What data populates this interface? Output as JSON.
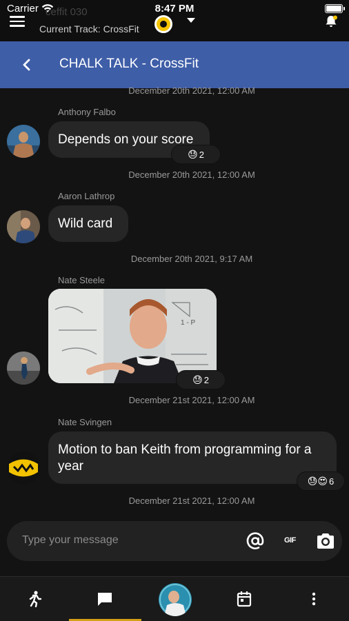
{
  "status": {
    "carrier": "Carrier",
    "time": "8:47 PM",
    "battery_level": 1.0
  },
  "header": {
    "ghost_text": "ceffit 030",
    "current_track": "Current Track: CrossFit"
  },
  "chat": {
    "title": "CHALK TALK - CrossFit"
  },
  "messages": [
    {
      "timestamp": "December 20th 2021, 12:00 AM"
    },
    {
      "author": "Anthony Falbo",
      "text": "Depends on your score",
      "reaction_emoji": "😓",
      "reaction_count": "2",
      "timestamp": "December 20th 2021, 12:00 AM"
    },
    {
      "author": "Aaron Lathrop",
      "text": "Wild card",
      "timestamp": "December 20th 2021, 9:17 AM"
    },
    {
      "author": "Nate Steele",
      "gif_text": "1 - P",
      "reaction_emoji": "😓",
      "reaction_count": "2",
      "timestamp": "December 21st 2021, 12:00 AM"
    },
    {
      "author": "Nate Svingen",
      "text": "Motion to ban Keith from programming for a year",
      "reaction_emoji": "😓😍",
      "reaction_count": "6",
      "timestamp": "December 21st 2021, 12:00 AM"
    }
  ],
  "composer": {
    "placeholder": "Type your message",
    "gif_label": "GIF"
  },
  "nav": {
    "items": [
      "activity",
      "chat",
      "profile",
      "calendar",
      "more"
    ],
    "active": "chat"
  },
  "colors": {
    "title_bar": "#3f5ea8",
    "bubble": "#262626",
    "active_tab": "#d4a017",
    "track_icon": "#f4c400"
  }
}
